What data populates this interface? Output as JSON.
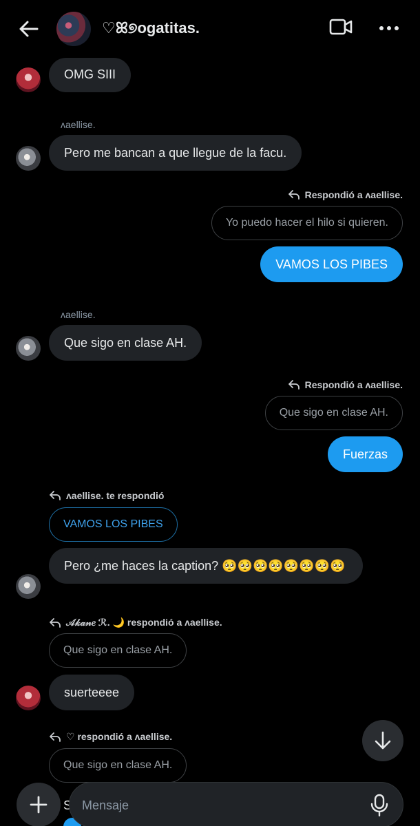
{
  "header": {
    "title": "♡ꕤ୭ogatitas.",
    "back_icon": "arrow-left-icon",
    "video_icon": "video-camera-icon",
    "more_icon": "more-horizontal-icon"
  },
  "messages": {
    "m1": {
      "text": "OMG SIII"
    },
    "m2": {
      "sender": "ʌaellise.",
      "text": "Pero me bancan a que llegue de la facu."
    },
    "m3": {
      "reply_note": "Respondió a ʌaellise.",
      "quoted": "Yo puedo hacer el hilo si quieren.",
      "text": "VAMOS LOS PIBES"
    },
    "m4": {
      "sender": "ʌaellise.",
      "text": "Que sigo en clase AH."
    },
    "m5": {
      "reply_note": "Respondió a ʌaellise.",
      "quoted": "Que sigo en clase AH.",
      "text": "Fuerzas"
    },
    "m6": {
      "reply_note": "ʌaellise. te respondió",
      "quoted": "VAMOS LOS PIBES",
      "text": "Pero ¿me haces la caption? 🥺🥺🥺🥺🥺🥺🥺🥺"
    },
    "m7": {
      "reply_note": "𝒜𝓀𝒶𝓃𝑒 ℛ. 🌙 respondió a ʌaellise.",
      "quoted": "Que sigo en clase AH.",
      "text": "suerteeee"
    },
    "m8": {
      "reply_note": "♡ respondió a ʌaellise.",
      "quoted": "Que sigo en clase AH.",
      "text_partial": "S"
    }
  },
  "composer": {
    "placeholder": "Mensaje",
    "add_icon": "plus-icon",
    "mic_icon": "microphone-icon"
  },
  "scroll_down_icon": "arrow-down-icon",
  "colors": {
    "background": "#000000",
    "incoming_bubble": "#202327",
    "outgoing_bubble": "#1d9bf0",
    "muted_text": "#8b98a5"
  }
}
